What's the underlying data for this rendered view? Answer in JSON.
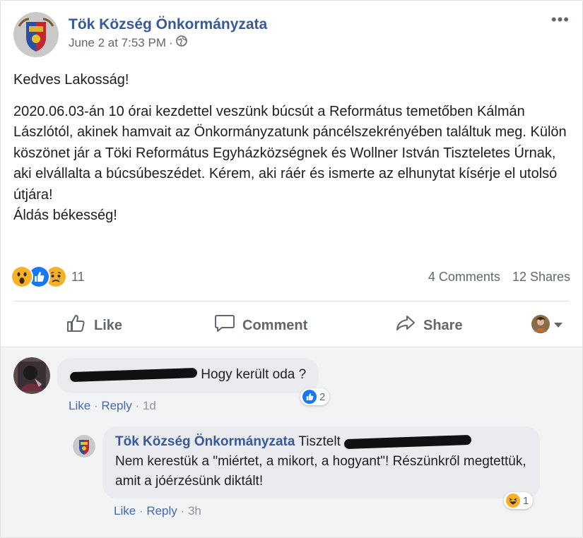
{
  "post": {
    "page_name": "Tök Község Önkormányzata",
    "date": "June 2 at 7:53 PM",
    "separator": "·",
    "privacy_icon": "globe-icon",
    "more_icon": "ellipsis-icon",
    "more_label": "•••",
    "greeting": "Kedves Lakosság!",
    "body": "2020.06.03-án 10 órai kezdettel veszünk búcsút a Református temetőben Kálmán Lászlótól, akinek hamvait az Önkormányzatunk páncélszekrényében találtuk meg. Külön köszönet jár a Töki Református Egyházközségnek és Wollner István Tiszteletes Úrnak, aki elvállalta a búcsúbeszédet. Kérem, aki ráér és ismerte az elhunytat kísérje el utolsó útjára!",
    "closing": "Áldás békesség!"
  },
  "reactions": {
    "icons": [
      "wow-icon",
      "like-icon",
      "sad-icon"
    ],
    "count": "11",
    "comments": "4 Comments",
    "shares": "12 Shares"
  },
  "actions": {
    "like": "Like",
    "comment": "Comment",
    "share": "Share"
  },
  "comments": [
    {
      "author": "[redacted]",
      "text": "Hogy került oda ?",
      "reaction_icon": "like-icon",
      "reaction_count": "2",
      "like": "Like",
      "reply": "Reply",
      "sep": "·",
      "time": "1d"
    },
    {
      "author": "Tök Község Önkormányzata",
      "text_lead": "Tisztelt",
      "text": "Nem kerestük a \"miértet, a mikort, a hogyant\"! Részünkről megtettük, amit a jóérzésünk diktált!",
      "reaction_icon": "haha-icon",
      "reaction_count": "1",
      "like": "Like",
      "reply": "Reply",
      "sep": "·",
      "time": "3h"
    }
  ],
  "colors": {
    "link": "#385898",
    "muted": "#606770",
    "like_blue": "#1877f2",
    "reaction_yellow": "#f7b125"
  }
}
